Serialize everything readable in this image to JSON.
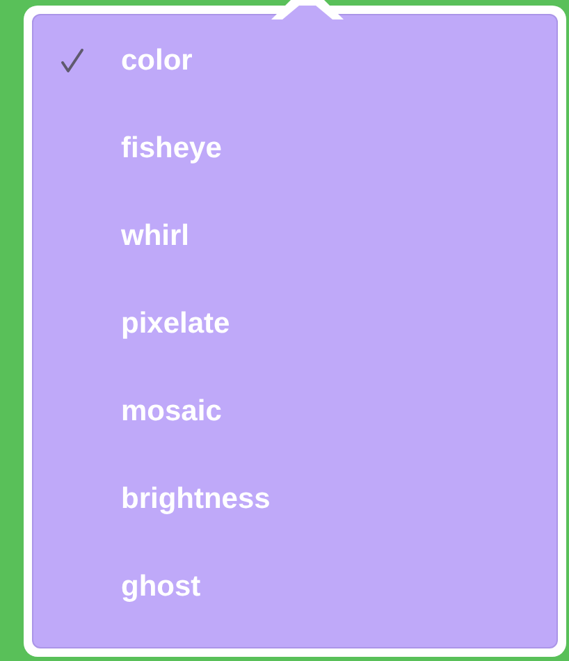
{
  "menu": {
    "items": [
      {
        "label": "color",
        "selected": true
      },
      {
        "label": "fisheye",
        "selected": false
      },
      {
        "label": "whirl",
        "selected": false
      },
      {
        "label": "pixelate",
        "selected": false
      },
      {
        "label": "mosaic",
        "selected": false
      },
      {
        "label": "brightness",
        "selected": false
      },
      {
        "label": "ghost",
        "selected": false
      }
    ]
  }
}
